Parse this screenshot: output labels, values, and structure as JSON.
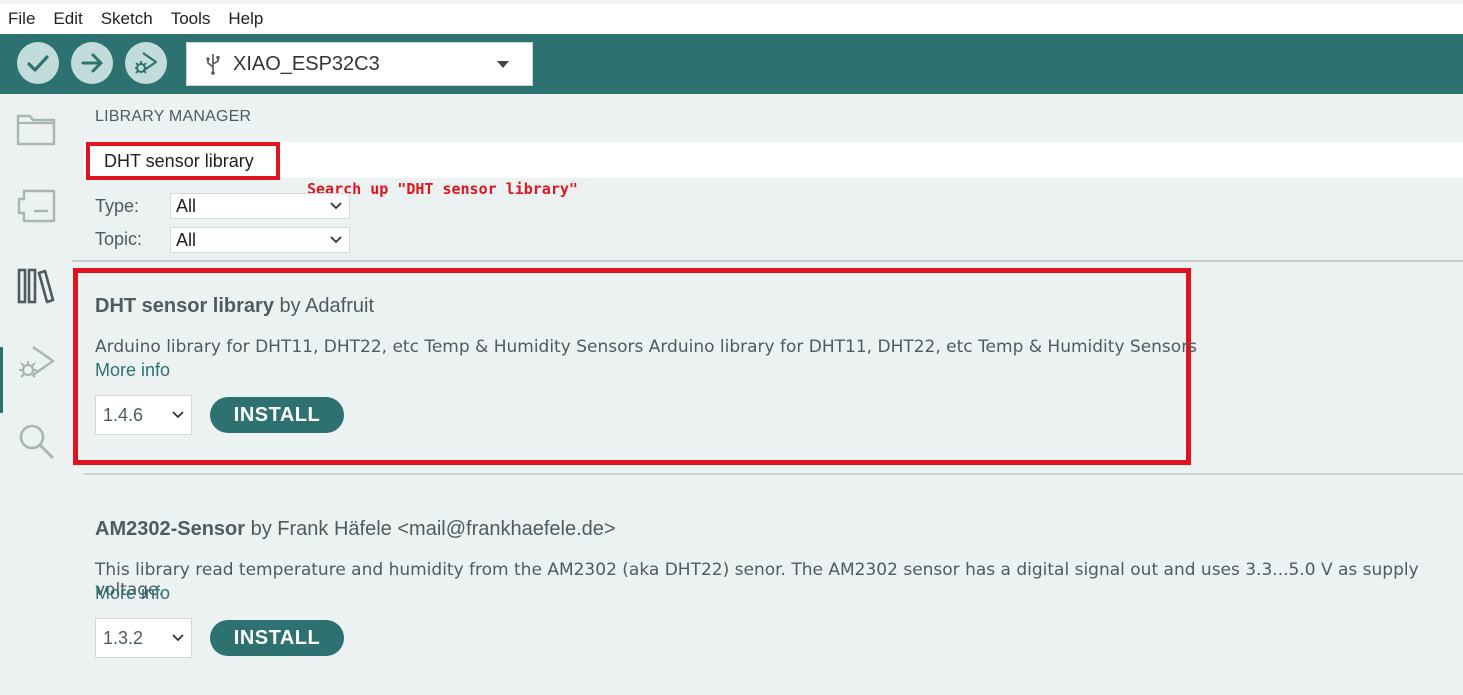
{
  "menu": [
    "File",
    "Edit",
    "Sketch",
    "Tools",
    "Help"
  ],
  "toolbar": {
    "board": "XIAO_ESP32C3",
    "buttons": [
      "verify-icon",
      "upload-icon",
      "debug-icon"
    ]
  },
  "sidebar": {
    "icons": [
      "folder-icon",
      "boards-manager-icon",
      "library-manager-icon",
      "debug-icon",
      "search-icon"
    ],
    "active": "library-manager-icon"
  },
  "library_manager": {
    "title": "LIBRARY MANAGER",
    "search_value": "DHT sensor library",
    "annotation": "Search up \"DHT sensor library\"",
    "filters": [
      {
        "label": "Type:",
        "value": "All"
      },
      {
        "label": "Topic:",
        "value": "All"
      }
    ],
    "libraries": [
      {
        "name": "DHT sensor library",
        "author": "by Adafruit",
        "description": "Arduino library for DHT11, DHT22, etc Temp & Humidity Sensors Arduino library for DHT11, DHT22, etc Temp & Humidity Sensors",
        "more_info": "More info",
        "version": "1.4.6",
        "install": "INSTALL"
      },
      {
        "name": "AM2302-Sensor",
        "author": "by Frank Häfele <mail@frankhaefele.de>",
        "description": "This library read temperature and humidity from the AM2302 (aka DHT22) senor. The AM2302 sensor has a digital signal out and uses 3.3...5.0 V as supply voltage.",
        "more_info": "More info",
        "version": "1.3.2",
        "install": "INSTALL"
      }
    ]
  },
  "colors": {
    "toolbar": "#2d7271",
    "highlight": "#e0141e",
    "panel": "#ecf1f1"
  }
}
